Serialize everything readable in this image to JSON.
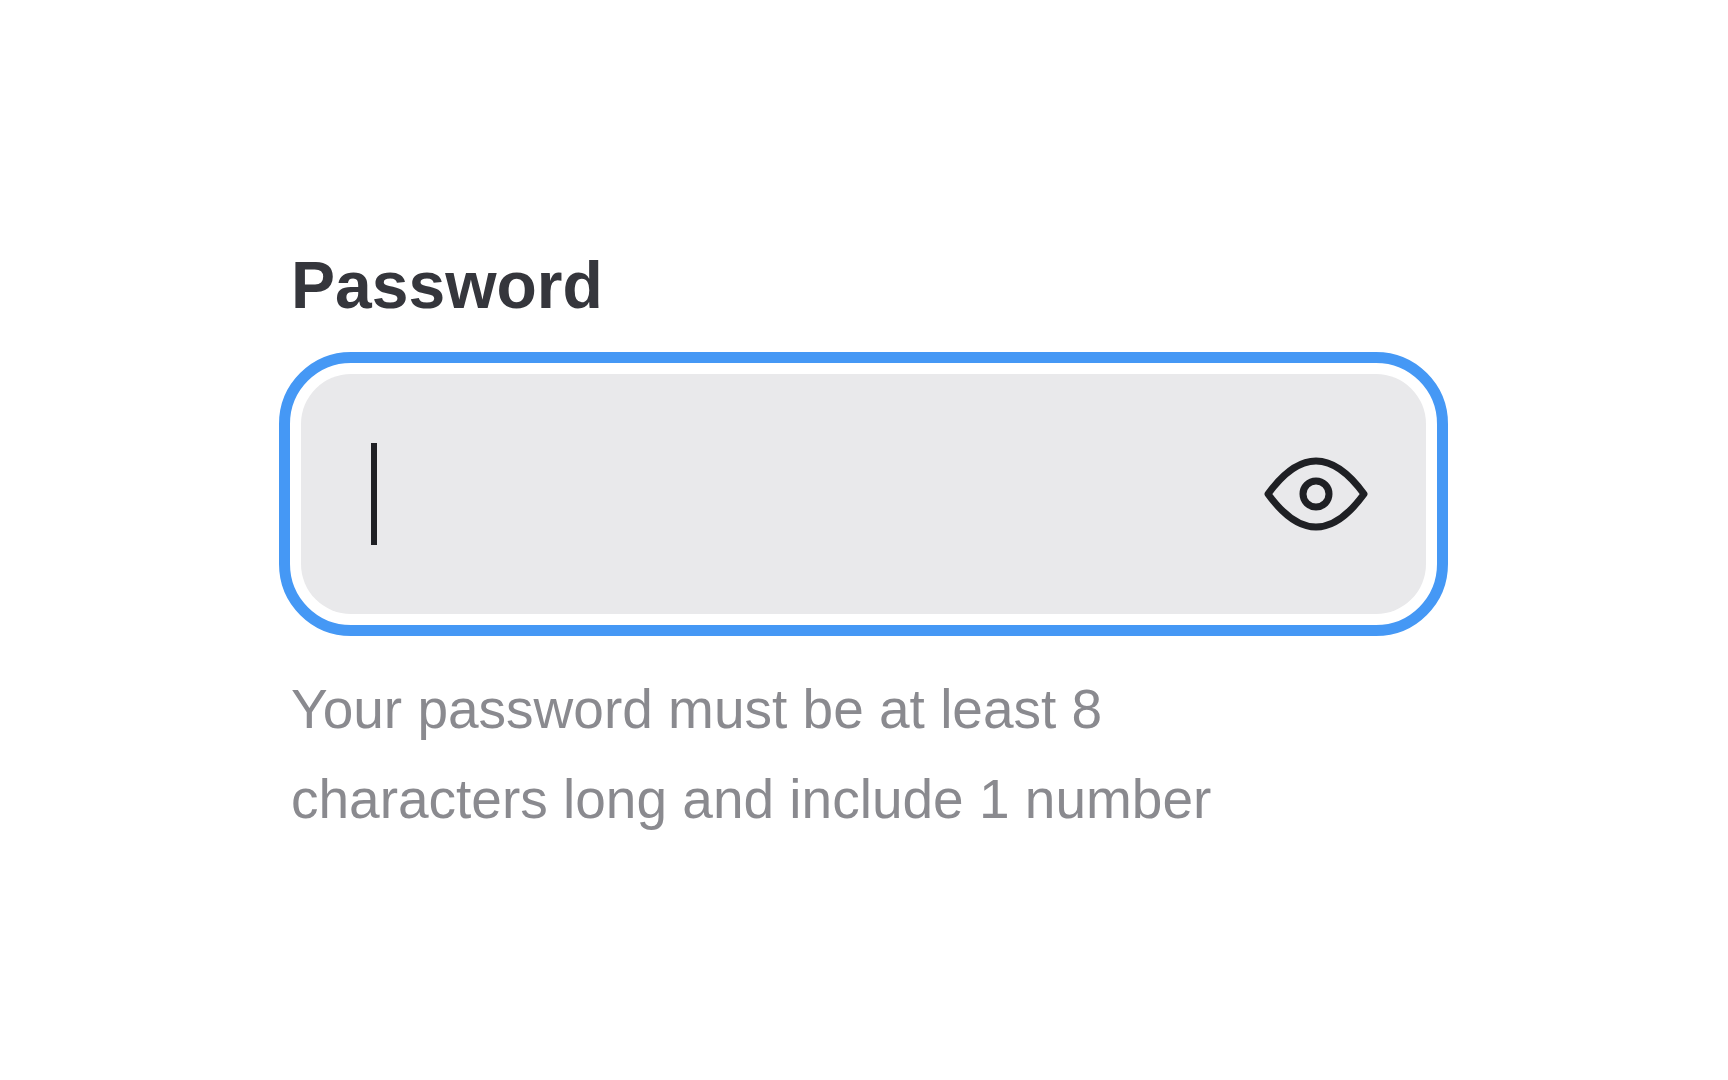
{
  "label": "Password",
  "field": {
    "focused": true,
    "password_visible": false
  },
  "help": "Your password must be at least 8 characters long and include 1 number"
}
